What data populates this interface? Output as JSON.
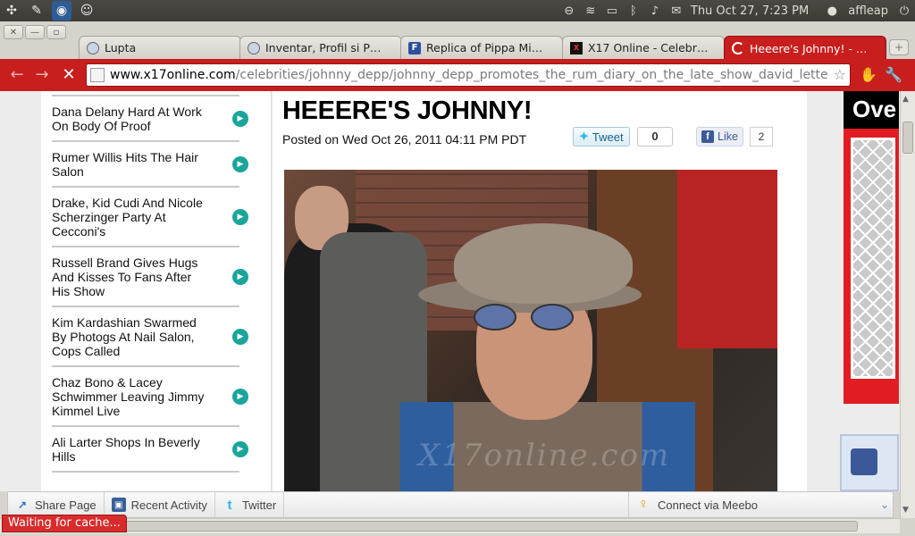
{
  "os_panel": {
    "clock": "Thu Oct 27,  7:23 PM",
    "user": "affleap"
  },
  "tabs": [
    {
      "title": "Lupta",
      "icon": "globe-icon",
      "active": false
    },
    {
      "title": "Inventar, Profil si P…",
      "icon": "globe-icon",
      "active": false
    },
    {
      "title": "Replica of Pippa Mi…",
      "icon": "f-site-icon",
      "active": false
    },
    {
      "title": "X17 Online - Celebr…",
      "icon": "x17-icon",
      "active": false
    },
    {
      "title": "Heeere's Johnny! - …",
      "icon": "loading-spinner-icon",
      "active": true
    }
  ],
  "address": {
    "host": "www.x17online.com",
    "path": "/celebrities/johnny_depp/johnny_depp_promotes_the_rum_diary_on_the_late_show_david_lette"
  },
  "sidebar": {
    "items": [
      {
        "label": "Dana Delany Hard At Work On Body Of Proof"
      },
      {
        "label": "Rumer Willis Hits The Hair Salon"
      },
      {
        "label": "Drake, Kid Cudi And Nicole Scherzinger Party At Cecconi's"
      },
      {
        "label": "Russell Brand Gives Hugs And Kisses To Fans After His Show"
      },
      {
        "label": "Kim Kardashian Swarmed By Photogs At Nail Salon, Cops Called"
      },
      {
        "label": "Chaz Bono & Lacey Schwimmer Leaving Jimmy Kimmel Live"
      },
      {
        "label": "Ali Larter Shops In Beverly Hills"
      }
    ]
  },
  "article": {
    "title": "HEEERE'S JOHNNY!",
    "posted": "Posted on Wed Oct 26, 2011 04:11 PM PDT",
    "tweet_label": "Tweet",
    "tweet_count": "0",
    "like_label": "Like",
    "like_count": "2",
    "photo_watermark": "X17online.com"
  },
  "ad": {
    "word": "Ove"
  },
  "socialbar": {
    "share": "Share Page",
    "activity": "Recent Activity",
    "twitter": "Twitter",
    "meebo": "Connect via Meebo"
  },
  "status": "Waiting for cache..."
}
